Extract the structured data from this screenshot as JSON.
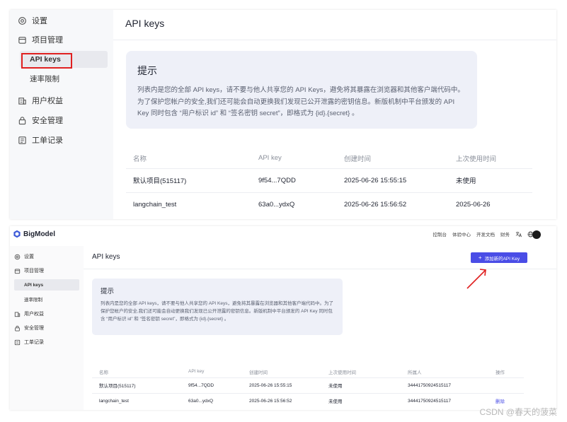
{
  "top_panel": {
    "sidebar": {
      "items": [
        {
          "label": "设置",
          "icon": "gear-icon"
        },
        {
          "label": "项目管理",
          "icon": "folder-icon"
        },
        {
          "label": "用户权益",
          "icon": "building-icon"
        },
        {
          "label": "安全管理",
          "icon": "lock-icon"
        },
        {
          "label": "工单记录",
          "icon": "ticket-icon"
        }
      ],
      "sub_items": [
        {
          "label": "API keys"
        },
        {
          "label": "速率限制"
        }
      ]
    },
    "page_title": "API keys",
    "tip": {
      "title": "提示",
      "body": "列表内是您的全部 API keys，请不要与他人共享您的 API Keys，避免将其暴露在浏览器和其他客户端代码中。为了保护您帐户的安全,我们还可能会自动更换我们发现已公开泄露的密钥信息。新版机制中平台颁发的 API Key 同时包含 “用户标识 id” 和 “签名密钥 secret”，即格式为 {id}.{secret} 。"
    },
    "table": {
      "headers": [
        "名称",
        "API key",
        "创建时间",
        "上次使用时间"
      ],
      "rows": [
        [
          "默认项目(515117)",
          "9f54...7QDD",
          "2025-06-26 15:55:15",
          "未使用"
        ],
        [
          "langchain_test",
          "63a0...ydxQ",
          "2025-06-26 15:56:52",
          "2025-06-26"
        ]
      ]
    }
  },
  "bottom_panel": {
    "brand": "BigModel",
    "nav": [
      "控制台",
      "体验中心",
      "开发文档",
      "财务"
    ],
    "nav_icons": [
      "translate-icon",
      "globe-icon"
    ],
    "sidebar": {
      "items": [
        {
          "label": "设置",
          "icon": "gear-icon"
        },
        {
          "label": "项目管理",
          "icon": "folder-icon"
        },
        {
          "label": "用户权益",
          "icon": "building-icon"
        },
        {
          "label": "安全管理",
          "icon": "lock-icon"
        },
        {
          "label": "工单记录",
          "icon": "ticket-icon"
        }
      ],
      "sub_items": [
        {
          "label": "API keys"
        },
        {
          "label": "速率限制"
        }
      ]
    },
    "page_title": "API keys",
    "add_button": "添加新的API Key",
    "tip": {
      "title": "提示",
      "body": "列表内是您的全部 API keys，请不要与他人共享您的 API Keys，避免将其暴露在浏览器和其他客户端代码中。为了保护您帐户的安全,我们还可能会自动更换我们发现已公开泄露的密钥信息。新版机制中平台颁发的 API Key 同时包含 “用户标识 id” 和 “签名密钥 secret”，即格式为 {id}.{secret} 。"
    },
    "table": {
      "headers": [
        "名称",
        "API key",
        "创建时间",
        "上次使用时间",
        "所属人",
        "操作"
      ],
      "rows": [
        [
          "默认项目(515117)",
          "9f54...7QDD",
          "2025-06-26 15:55:15",
          "未使用",
          "34441750924515117",
          ""
        ],
        [
          "langchain_test",
          "63a0...ydxQ",
          "2025-06-26 15:56:52",
          "未使用",
          "34441750924515117",
          "删除"
        ]
      ]
    }
  },
  "watermark": "CSDN @春天的菠菜",
  "colors": {
    "accent": "#4a4de6",
    "highlight_box": "#e02020",
    "tip_bg": "#eef0f8",
    "sidebar_bg": "#f7f8fa"
  }
}
